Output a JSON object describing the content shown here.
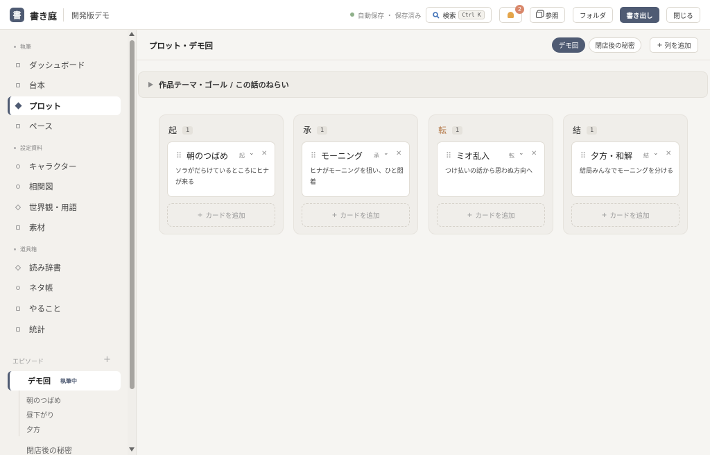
{
  "header": {
    "logo": "書",
    "app_name": "書き庭",
    "app_sub": "開発版デモ",
    "autosave": "自動保存 ・ 保存済み",
    "search_label": "検索",
    "search_shortcut": "Ctrl K",
    "notification_count": "2",
    "reference_label": "参照",
    "folder_label": "フォルダ",
    "export_label": "書き出し",
    "close_label": "閉じる"
  },
  "sidebar": {
    "sections": [
      {
        "label": "執筆",
        "items": [
          {
            "label": "ダッシュボード",
            "icon": "square-icon"
          },
          {
            "label": "台本",
            "icon": "square-icon"
          },
          {
            "label": "プロット",
            "icon": "diamond-icon",
            "active": true
          },
          {
            "label": "ペース",
            "icon": "square-icon"
          }
        ]
      },
      {
        "label": "設定資料",
        "items": [
          {
            "label": "キャラクター",
            "icon": "circle-icon"
          },
          {
            "label": "相関図",
            "icon": "circle-icon"
          },
          {
            "label": "世界観・用語",
            "icon": "diamond-icon"
          },
          {
            "label": "素材",
            "icon": "square-icon"
          }
        ]
      },
      {
        "label": "道具箱",
        "items": [
          {
            "label": "読み辞書",
            "icon": "diamond-icon"
          },
          {
            "label": "ネタ帳",
            "icon": "circle-icon"
          },
          {
            "label": "やること",
            "icon": "square-icon"
          },
          {
            "label": "統計",
            "icon": "square-icon"
          }
        ]
      }
    ],
    "episodes_label": "エピソード",
    "active_episode": {
      "title": "デモ回",
      "badge": "執筆中"
    },
    "episode_scenes": [
      "朝のつばめ",
      "昼下がり",
      "夕方"
    ],
    "other_episode": "閉店後の秘密"
  },
  "main": {
    "title": "プロット・デモ回",
    "episode_tabs": [
      {
        "label": "デモ回",
        "active": true
      },
      {
        "label": "閉店後の秘密",
        "active": false
      }
    ],
    "add_column_label": "列を追加",
    "theme_label": "作品テーマ・ゴール / この話のねらい",
    "columns": [
      {
        "name": "起",
        "count": "1",
        "accent": false,
        "card": {
          "title": "朝のつばめ",
          "tag": "起",
          "desc": "ソラがだらけているところにヒナが来る"
        }
      },
      {
        "name": "承",
        "count": "1",
        "accent": false,
        "card": {
          "title": "モーニング",
          "tag": "承",
          "desc": "ヒナがモーニングを狙い、ひと悶着"
        }
      },
      {
        "name": "転",
        "count": "1",
        "accent": true,
        "card": {
          "title": "ミオ乱入",
          "tag": "転",
          "desc": "つけ払いの話から思わぬ方向へ"
        }
      },
      {
        "name": "結",
        "count": "1",
        "accent": false,
        "card": {
          "title": "夕方・和解",
          "tag": "結",
          "desc": "結局みんなでモーニングを分ける"
        }
      }
    ],
    "add_card_label": "カードを追加"
  },
  "colors": {
    "accent": "#4f5b73",
    "notification": "#d9876a",
    "column_accent": "#b57a4a"
  }
}
